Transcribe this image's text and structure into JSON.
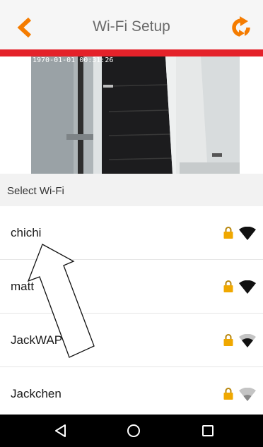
{
  "header": {
    "title": "Wi-Fi Setup",
    "back_icon": "chevron-left-icon",
    "refresh_icon": "refresh-icon",
    "accent_color": "#f57c00",
    "bar_color": "#e4222a"
  },
  "camera": {
    "timestamp": "1970-01-01 00:31:26"
  },
  "section": {
    "label": "Select Wi-Fi"
  },
  "networks": [
    {
      "name": "chichi",
      "locked": true,
      "signal": "full"
    },
    {
      "name": "matt",
      "locked": true,
      "signal": "full"
    },
    {
      "name": "JackWAP",
      "locked": true,
      "signal": "medium"
    },
    {
      "name": "Jackchen",
      "locked": true,
      "signal": "weak"
    }
  ],
  "navbar": {
    "back_icon": "triangle-back-icon",
    "home_icon": "circle-home-icon",
    "recents_icon": "square-recents-icon"
  }
}
